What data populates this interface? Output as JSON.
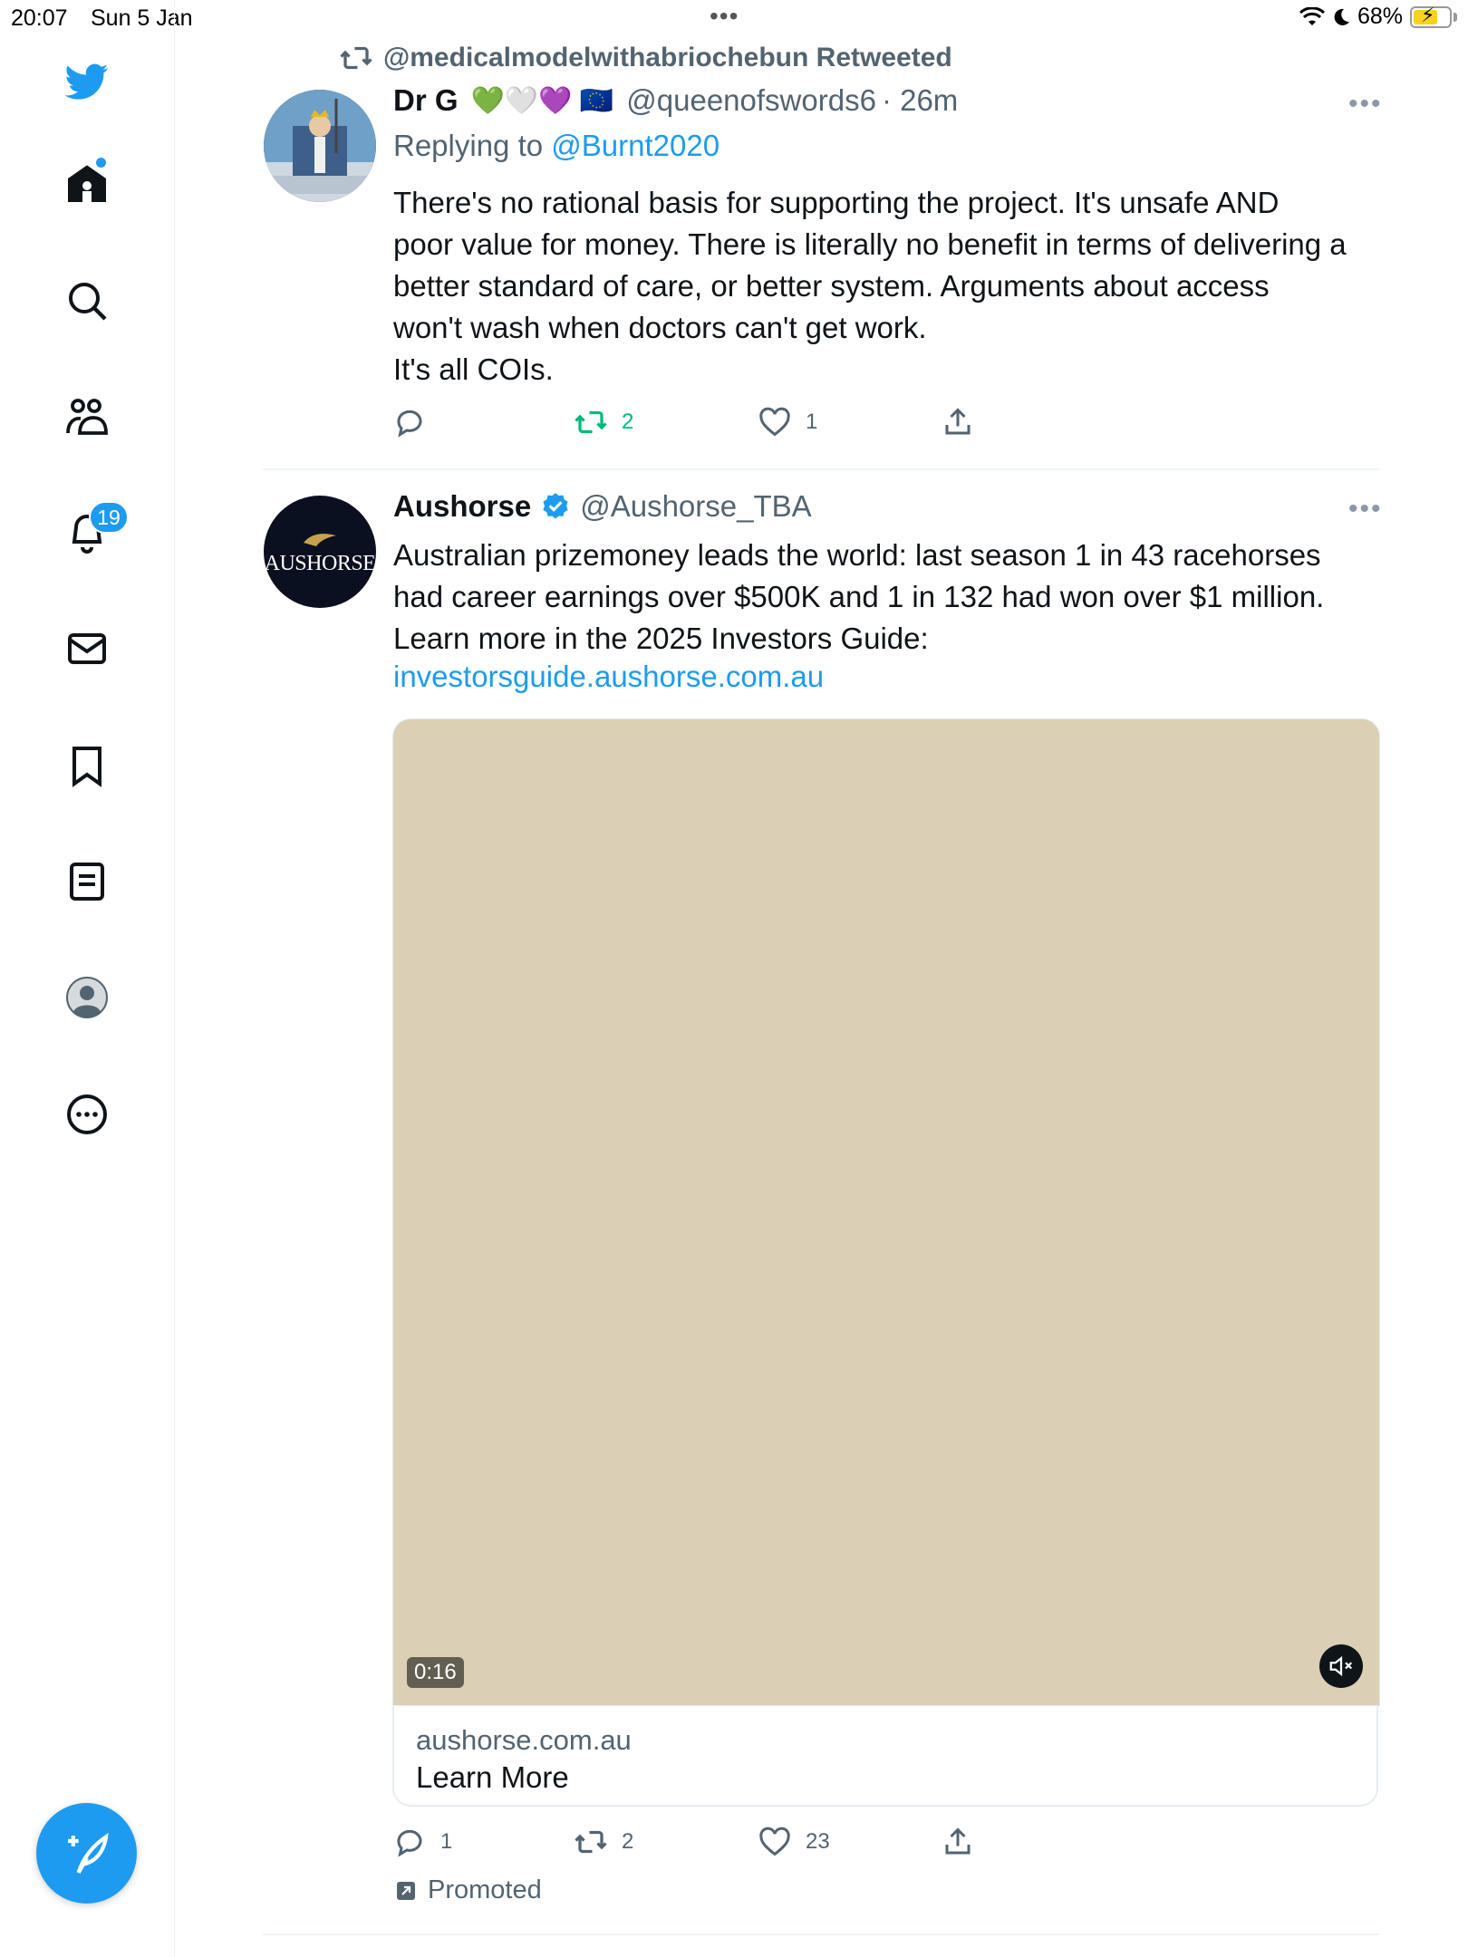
{
  "status_bar": {
    "time": "20:07",
    "date": "Sun 5 Jan",
    "battery": "68%",
    "battery_level": 0.68
  },
  "sidebar": {
    "notification_count": "19",
    "items": [
      {
        "name": "twitter-logo-icon"
      },
      {
        "name": "home-icon"
      },
      {
        "name": "explore-icon"
      },
      {
        "name": "communities-icon"
      },
      {
        "name": "notifications-icon"
      },
      {
        "name": "messages-icon"
      },
      {
        "name": "bookmarks-icon"
      },
      {
        "name": "lists-icon"
      },
      {
        "name": "profile-icon"
      },
      {
        "name": "more-icon"
      }
    ],
    "compose": {
      "name": "compose-tweet-icon"
    }
  },
  "tweets": [
    {
      "retweeted_by": "@medicalmodelwithabriochebun Retweeted",
      "name": "Dr G",
      "name_emoji": "💚🤍💜 🇪🇺",
      "handle": "@queenofswords6",
      "time": "· 26m",
      "replying_prefix": "Replying to ",
      "replying_to": "@Burnt2020",
      "text": "There's no rational basis for supporting the project. It's unsafe AND\npoor value for money. There is literally no benefit in terms of delivering a\nbetter standard of care, or better system. Arguments about access\nwon't wash when doctors can't get work.\nIt's all COIs.",
      "replies": "",
      "retweets": "2",
      "likes": "1"
    },
    {
      "name": "Aushorse",
      "handle": "@Aushorse_TBA",
      "avatar_text": "AUSHORSE",
      "text": "Australian prizemoney leads the world: last season 1 in 43 racehorses\nhad career earnings over $500K and 1 in 132 had won over $1 million.\nLearn more in the 2025 Investors Guide:",
      "link": "investorsguide.aushorse.com.au",
      "video_duration": "0:16",
      "card_domain": "aushorse.com.au",
      "card_cta": "Learn More",
      "replies": "1",
      "retweets": "2",
      "likes": "23",
      "promoted": "Promoted"
    }
  ],
  "colors": {
    "accent": "#1d9bf0",
    "retweet_green": "#00ba7c",
    "text_secondary": "#536471",
    "media_placeholder": "#dbd0b5"
  }
}
